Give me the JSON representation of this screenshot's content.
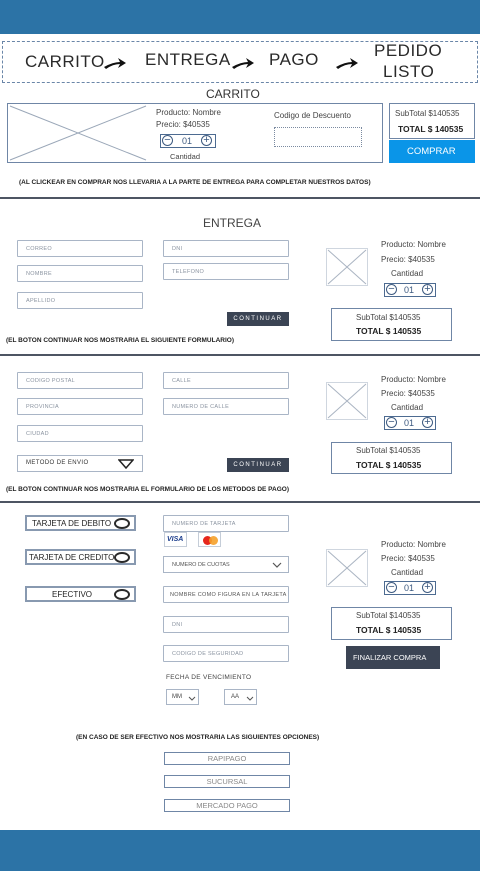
{
  "steps": {
    "carrito": "CARRITO",
    "entrega": "ENTREGA",
    "pago": "PAGO",
    "pedido_line1": "PEDIDO",
    "pedido_line2": "LISTO"
  },
  "cart": {
    "title": "CARRITO",
    "product_name": "Producto: Nombre",
    "price": "Precio: $40535",
    "qty": "01",
    "qty_label": "Cantidad",
    "discount_label": "Codigo de Descuento",
    "subtotal": "SubTotal $140535",
    "total": "TOTAL $ 140535",
    "buy_button": "COMPRAR",
    "note": "(AL CLICKEAR EN COMPRAR NOS LLEVARIA A LA PARTE DE ENTREGA PARA COMPLETAR NUESTROS DATOS)"
  },
  "delivery": {
    "title": "ENTREGA",
    "fields": {
      "correo": "CORREO",
      "nombre": "NOMBRE",
      "apellido": "APELLIDO",
      "dni": "DNI",
      "telefono": "TELEFONO"
    },
    "continue_button": "CONTINUAR",
    "note": "(EL BOTON CONTINUAR NOS MOSTRARIA EL SIGUIENTE FORMULARIO)"
  },
  "address": {
    "fields": {
      "codigo_postal": "CODIGO POSTAL",
      "provincia": "PROVINCIA",
      "ciudad": "CIUDAD",
      "calle": "CALLE",
      "numero_calle": "NUMERO DE CALLE"
    },
    "shipping_select": "METODO DE ENVIO",
    "continue_button": "CONTINUAR",
    "note": "(EL BOTON CONTINUAR NOS MOSTRARIA EL FORMULARIO DE LOS METODOS DE PAGO)"
  },
  "payment": {
    "methods": {
      "debito": "TARJETA DE DEBITO",
      "credito": "TARJETA DE CREDITO",
      "efectivo": "EFECTIVO"
    },
    "fields": {
      "numero_tarjeta": "NUMERO DE TARJETA",
      "cuotas": "NUMERO DE CUOTAS",
      "nombre_tarjeta": "NOMBRE COMO FIGURA EN LA TARJETA",
      "dni": "DNI",
      "codigo_seguridad": "CODIGO DE SEGURIDAD"
    },
    "card_visa": "VISA",
    "expiry_label": "FECHA DE VENCIMIENTO",
    "month_select": "MM",
    "year_select": "AA",
    "finish_button": "FINALIZAR COMPRA",
    "cash_note": "(EN CASO DE SER EFECTIVO NOS MOSTRARIA LAS SIGUIENTES OPCIONES)",
    "cash_options": [
      "RAPIPAGO",
      "SUCURSAL",
      "MERCADO PAGO"
    ]
  },
  "summary": {
    "product_name": "Producto: Nombre",
    "price": "Precio: $40535",
    "qty_label": "Cantidad",
    "qty": "01",
    "subtotal": "SubTotal $140535",
    "total": "TOTAL $ 140535"
  },
  "colors": {
    "header_blue": "#2c73a6",
    "buy_button": "#0a95e8",
    "dark_button": "#3b4454"
  }
}
